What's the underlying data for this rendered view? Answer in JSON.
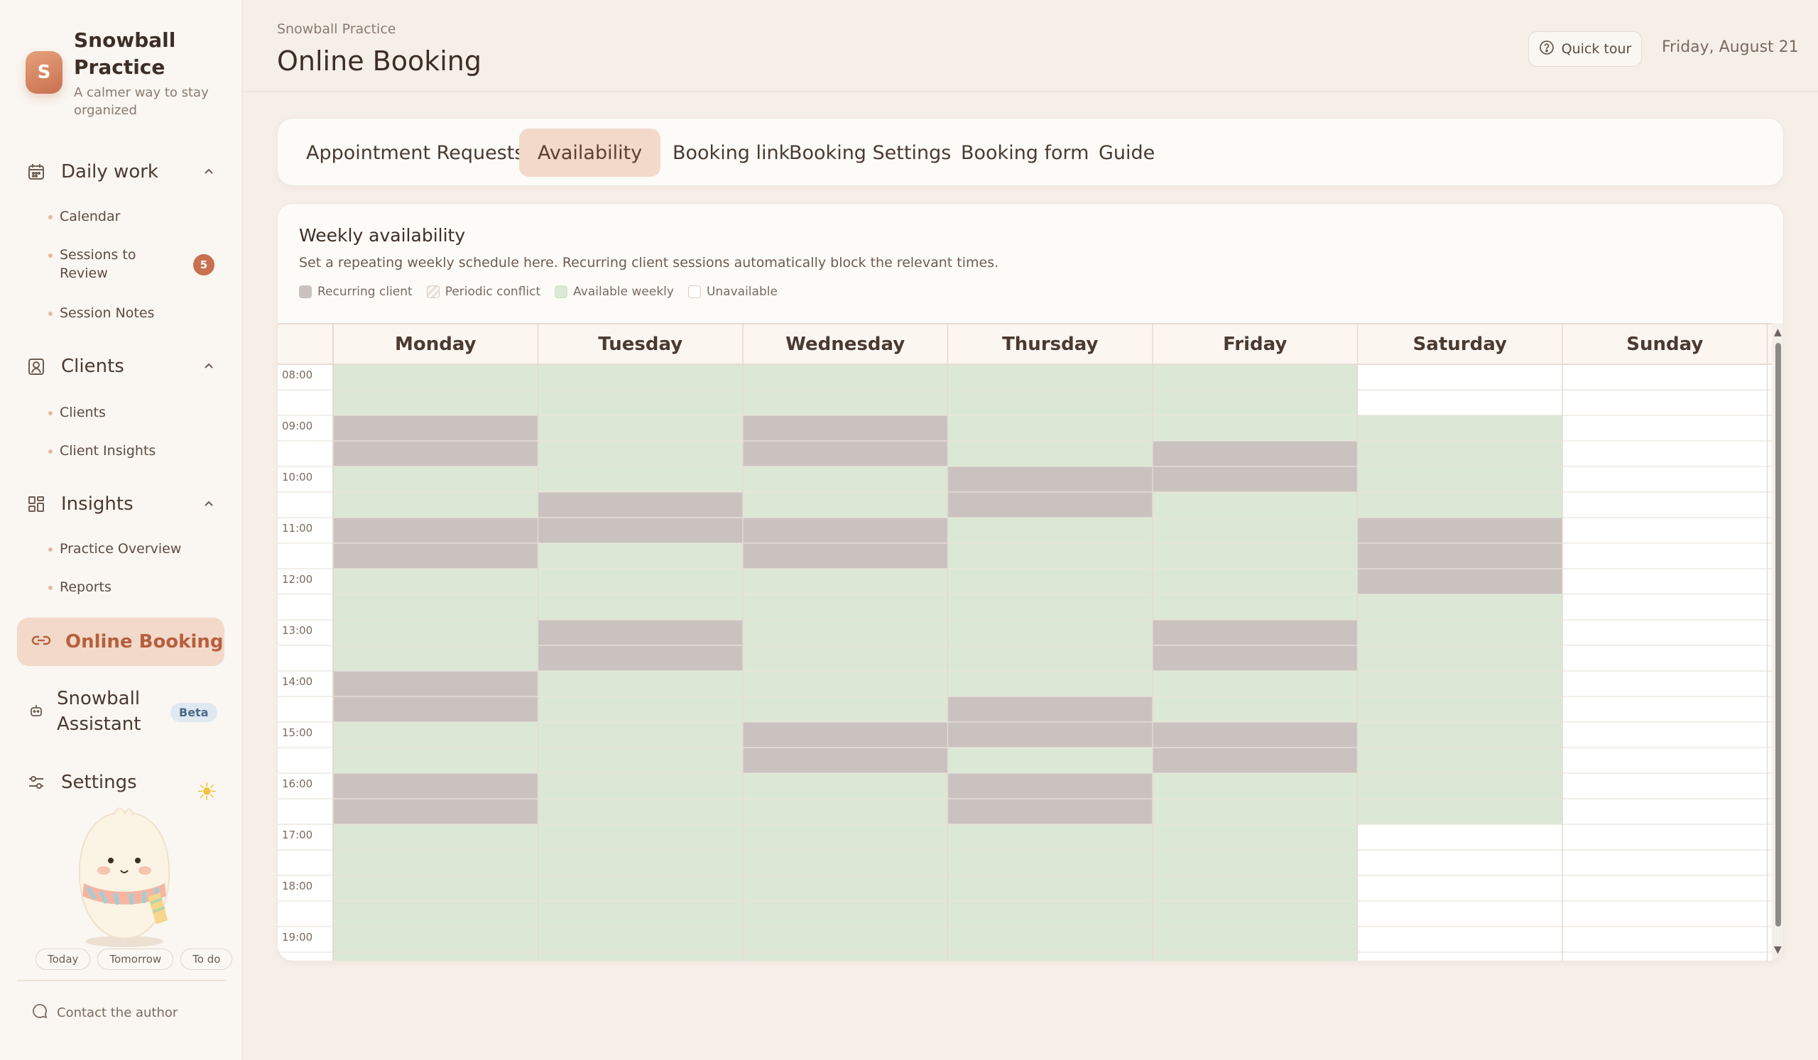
{
  "brand": {
    "initial": "S",
    "name": "Snowball Practice",
    "tagline": "A calmer way to stay organized"
  },
  "nav": {
    "daily_work": {
      "label": "Daily work",
      "items": [
        "Calendar",
        "Sessions to Review",
        "Session Notes"
      ],
      "review_count": "5"
    },
    "clients": {
      "label": "Clients",
      "items": [
        "Clients",
        "Client Insights"
      ]
    },
    "insights": {
      "label": "Insights",
      "items": [
        "Practice Overview",
        "Reports"
      ]
    },
    "online_booking": "Online Booking",
    "assistant": {
      "label": "Snowball Assistant",
      "badge": "Beta"
    },
    "settings": "Settings",
    "quick": [
      "Today",
      "Tomorrow",
      "To do"
    ],
    "contact": "Contact the author"
  },
  "header": {
    "breadcrumb": "Snowball Practice",
    "title": "Online Booking",
    "quick_tour": "Quick tour",
    "date": "Friday, August 21"
  },
  "tabs": [
    "Appointment Requests",
    "Availability",
    "Booking link",
    "Booking Settings",
    "Booking form",
    "Guide"
  ],
  "active_tab": "Availability",
  "availability": {
    "title": "Weekly availability",
    "subtitle": "Set a repeating weekly schedule here. Recurring client sessions automatically block the relevant times.",
    "legend": [
      "Recurring client",
      "Periodic conflict",
      "Available weekly",
      "Unavailable"
    ],
    "days": [
      "Monday",
      "Tuesday",
      "Wednesday",
      "Thursday",
      "Friday",
      "Saturday",
      "Sunday"
    ],
    "hours": [
      "08:00",
      "09:00",
      "10:00",
      "11:00",
      "12:00",
      "13:00",
      "14:00",
      "15:00",
      "16:00",
      "17:00",
      "18:00",
      "19:00"
    ],
    "available": {
      "Monday": [
        "08:00",
        "20:00"
      ],
      "Tuesday": [
        "08:00",
        "20:00"
      ],
      "Wednesday": [
        "08:00",
        "20:00"
      ],
      "Thursday": [
        "08:00",
        "20:00"
      ],
      "Friday": [
        "08:00",
        "20:00"
      ],
      "Saturday": [
        "09:00",
        "17:00"
      ]
    },
    "recurring": {
      "Monday": [
        [
          "09:00",
          "10:00"
        ],
        [
          "11:00",
          "12:00"
        ],
        [
          "14:00",
          "15:00"
        ],
        [
          "16:00",
          "17:00"
        ]
      ],
      "Tuesday": [
        [
          "10:30",
          "11:30"
        ],
        [
          "13:00",
          "14:00"
        ]
      ],
      "Wednesday": [
        [
          "09:00",
          "10:00"
        ],
        [
          "11:00",
          "12:00"
        ],
        [
          "15:00",
          "16:00"
        ]
      ],
      "Thursday": [
        [
          "10:00",
          "11:00"
        ],
        [
          "14:30",
          "15:30"
        ],
        [
          "16:00",
          "17:00"
        ]
      ],
      "Friday": [
        [
          "09:30",
          "10:30"
        ],
        [
          "13:00",
          "14:00"
        ],
        [
          "15:00",
          "16:00"
        ]
      ],
      "Saturday": [
        [
          "11:00",
          "12:30"
        ]
      ]
    },
    "colors": {
      "available": "#dbe8d5",
      "recurring": "#c9c2bf",
      "unavailable": "#ffffff",
      "accent": "#c8714f"
    }
  }
}
